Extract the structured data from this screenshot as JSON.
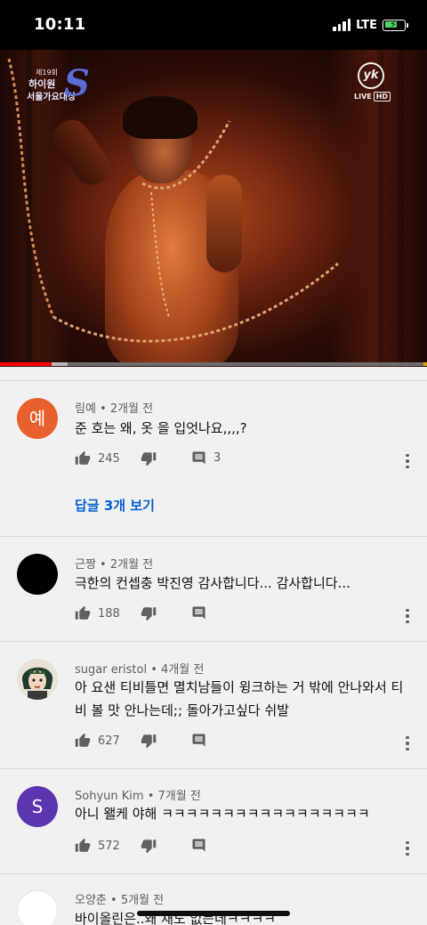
{
  "status_bar": {
    "time": "10:11",
    "network": "LTE"
  },
  "video": {
    "logo_left": {
      "line1": "제19회",
      "line2": "하이원",
      "line3": "서울가요대상",
      "mark": "S"
    },
    "logo_right": {
      "mark": "yk",
      "live": "LIVE",
      "hd": "HD"
    },
    "progress": {
      "played_fraction": 0.12,
      "buffered_fraction": 0.158
    }
  },
  "comments": [
    {
      "author": "림예",
      "time": "2개월 전",
      "avatar_letter": "예",
      "avatar_color": "#e8602c",
      "text": "준 호는 왜, 옷 을 입엇나요,,,,?",
      "likes": "245",
      "replies_count": "3",
      "view_replies": "답글 3개 보기"
    },
    {
      "author": "근짱",
      "time": "2개월 전",
      "avatar_letter": "",
      "avatar_color": "#000000",
      "text": "극한의 컨셉충 박진영 감사합니다... 감사합니다...",
      "likes": "188"
    },
    {
      "author": "sugar eristol",
      "time": "4개월 전",
      "avatar_letter": "",
      "avatar_color": "#2b2b2b",
      "text": "아 요샌 티비틀면 멸치남들이 윙크하는 거 밖에 안나와서 티비 볼 맛 안나는데;; 돌아가고싶다 쉬발",
      "likes": "627"
    },
    {
      "author": "Sohyun Kim",
      "time": "7개월 전",
      "avatar_letter": "S",
      "avatar_color": "#5e35b1",
      "text": "아니 왤케 야해 ㅋㅋㅋㅋㅋㅋㅋㅋㅋㅋㅋㅋㅋㅋㅋㅋㅋ",
      "likes": "572"
    },
    {
      "author": "오양춘",
      "time": "5개월 전",
      "avatar_letter": "",
      "avatar_color": "#ffffff",
      "text": "바이올린은..왜 재도 없는데ㅋㅋㅋㅋ"
    }
  ],
  "icons": {
    "like": "thumb-up-icon",
    "dislike": "thumb-down-icon",
    "reply": "comment-icon",
    "more": "more-vert-icon"
  }
}
